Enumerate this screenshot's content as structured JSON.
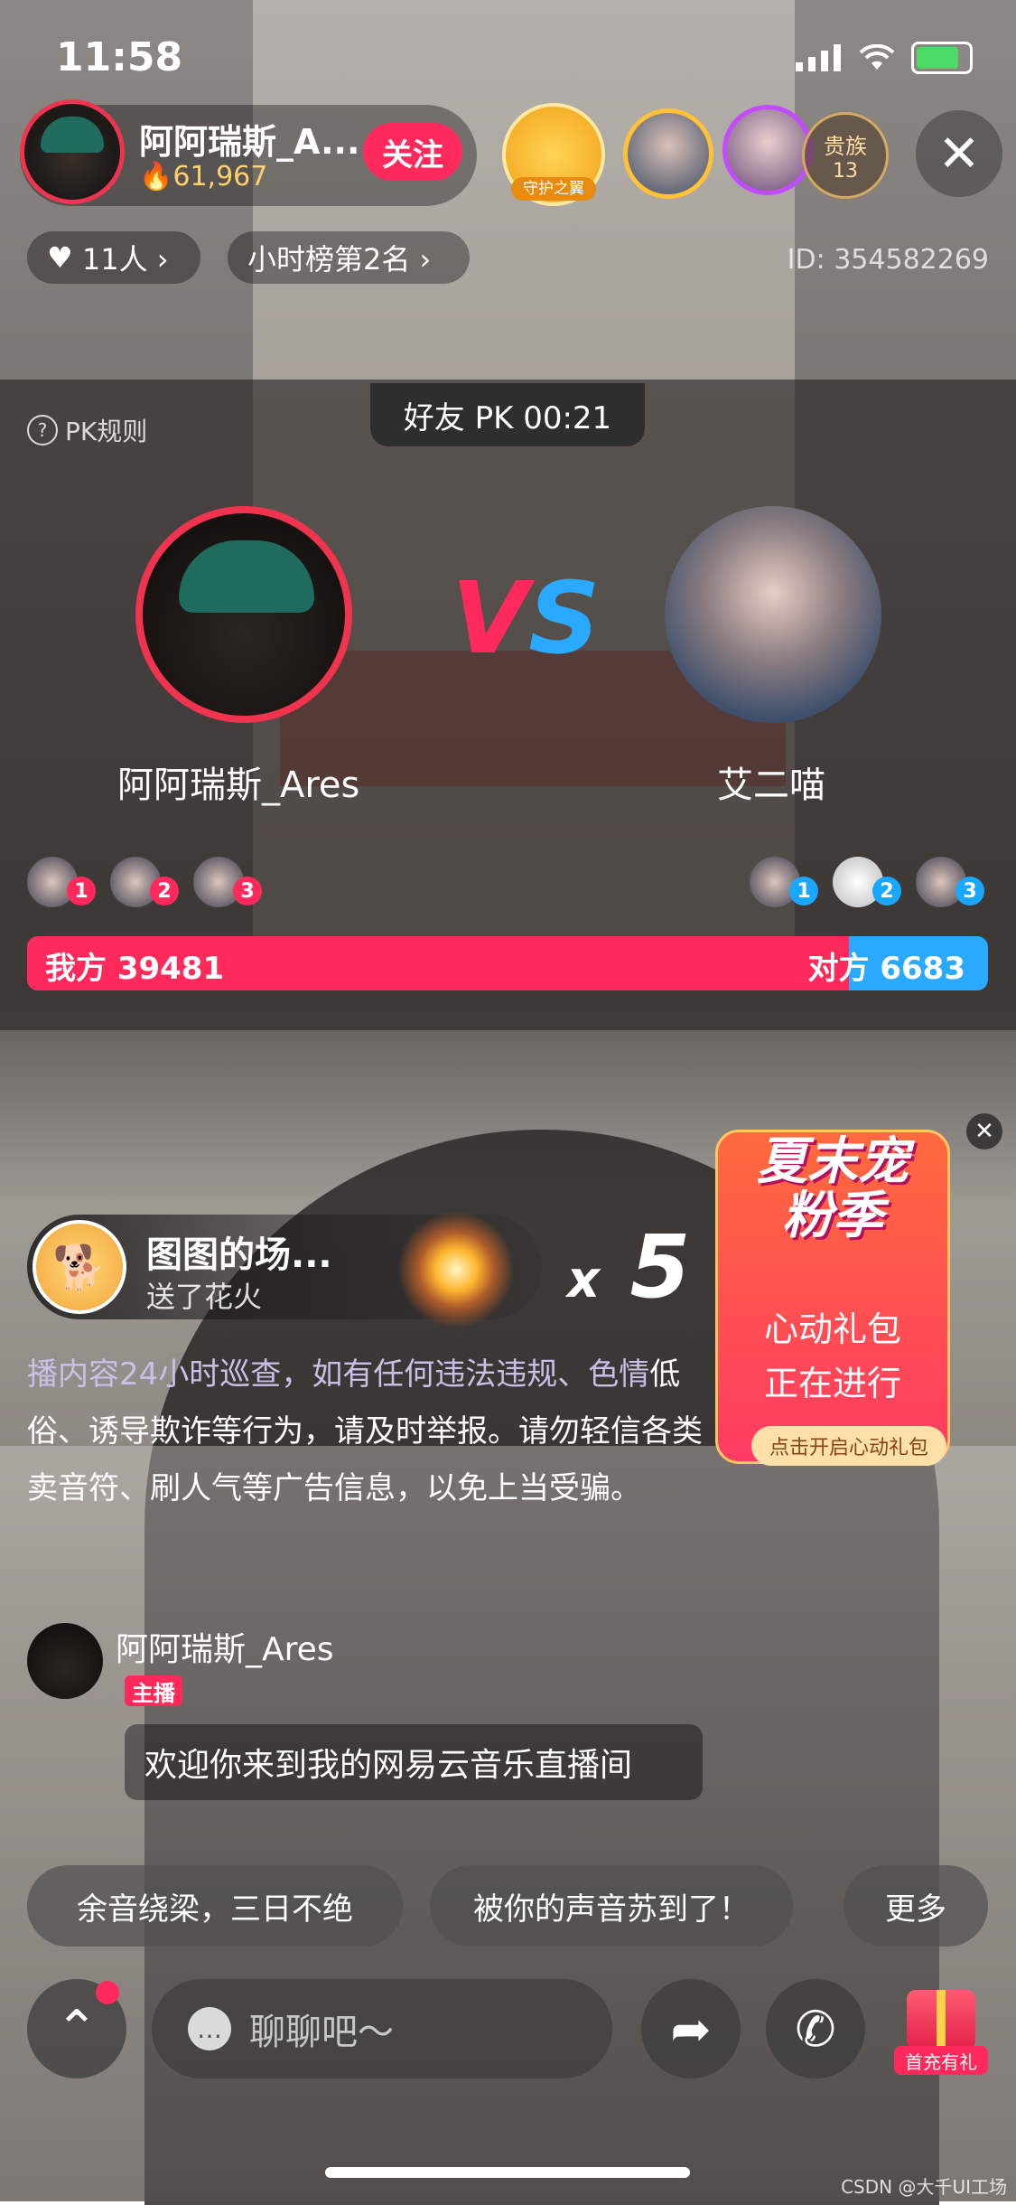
{
  "status": {
    "time": "11:58"
  },
  "host": {
    "name": "阿阿瑞斯_A...",
    "fans": "61,967",
    "follow_label": "关注"
  },
  "guard": {
    "label": "守护之翼"
  },
  "noble": {
    "label": "贵族",
    "count": "13"
  },
  "chips": {
    "fans": "11人 ›",
    "rank": "小时榜第2名 ›",
    "room_id": "ID: 354582269"
  },
  "pk": {
    "timer": "好友 PK 00:21",
    "rules": "PK规则",
    "left_name": "阿阿瑞斯_Ares",
    "right_name": "艾二喵",
    "left_score_label": "我方 39481",
    "right_score_label": "对方 6683",
    "left_score": 39481,
    "right_score": 6683,
    "left_ranks": [
      "1",
      "2",
      "3"
    ],
    "right_ranks": [
      "1",
      "2",
      "3"
    ]
  },
  "gift": {
    "user": "图图的场...",
    "action": "送了花火",
    "count_prefix": "x",
    "count": "5"
  },
  "promo": {
    "title": "夏末宠粉季",
    "line1": "心动礼包",
    "line2": "正在进行",
    "button": "点击开启心动礼包"
  },
  "notice": {
    "faded": "播内容24小时巡查，如有任何违法违规、色情",
    "rest": "低俗、诱导欺诈等行为，请及时举报。请勿轻信各类卖音符、刷人气等广告信息，以免上当受骗。"
  },
  "chat": {
    "name": "阿阿瑞斯_Ares",
    "badge": "主播",
    "message": "欢迎你来到我的网易云音乐直播间"
  },
  "quick_replies": [
    "余音绕梁，三日不绝",
    "被你的声音苏到了！",
    "更多"
  ],
  "bottom": {
    "placeholder": "聊聊吧～",
    "gift_tag": "首充有礼"
  },
  "watermark": "CSDN @大千UI工场",
  "colors": {
    "accent_red": "#ff2a5b",
    "accent_blue": "#29a9ff"
  }
}
